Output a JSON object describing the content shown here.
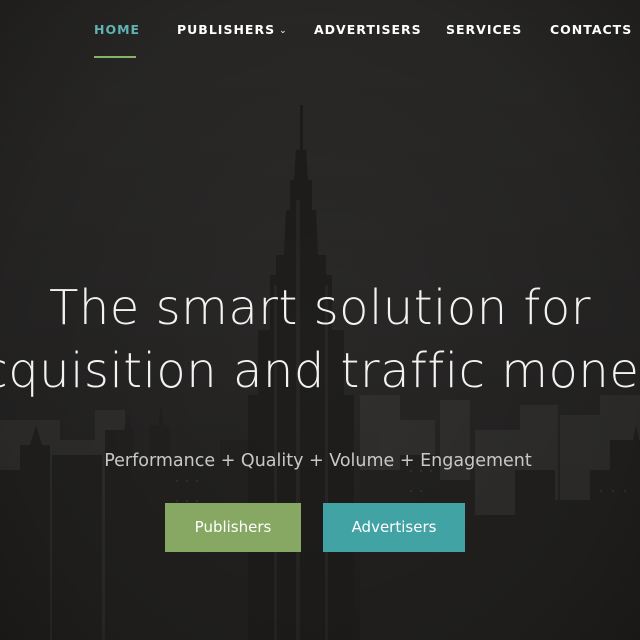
{
  "nav": {
    "items": [
      {
        "label": "HOME",
        "active": true
      },
      {
        "label": "PUBLISHERS",
        "has_dropdown": true
      },
      {
        "label": "ADVERTISERS"
      },
      {
        "label": "SERVICES"
      },
      {
        "label": "CONTACTS"
      }
    ],
    "active_color": "#5fb3b3",
    "underline_color": "#84b36a"
  },
  "hero": {
    "title_line1": "The smart solution for",
    "title_line2": "cquisition and traffic monet",
    "tagline": "Performance + Quality + Volume + Engagement",
    "buttons": {
      "publishers_label": "Publishers",
      "advertisers_label": "Advertisers"
    },
    "button_colors": {
      "publishers": "#86a862",
      "advertisers": "#42a3a5"
    }
  }
}
